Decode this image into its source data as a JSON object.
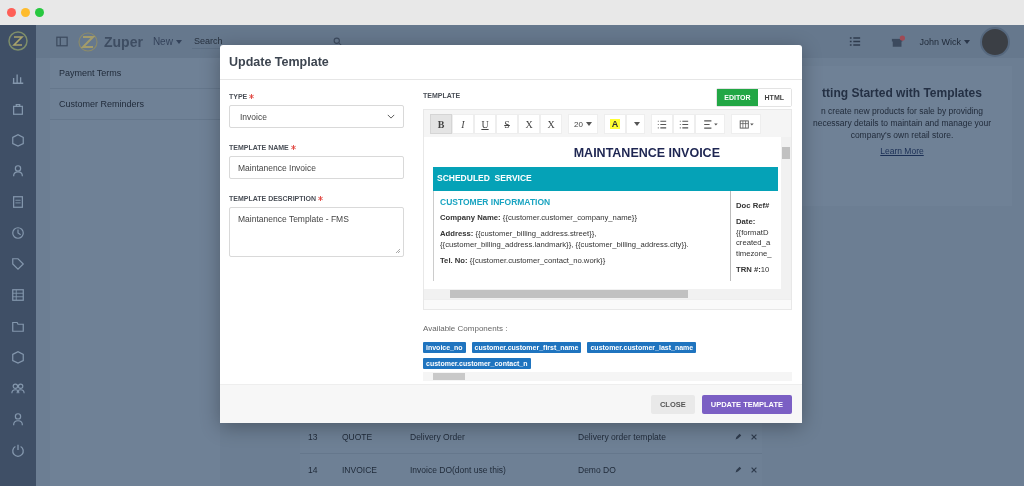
{
  "app": {
    "brand": "Zuper",
    "new_menu": "New",
    "search": {
      "placeholder": "Search"
    },
    "user": "John Wick"
  },
  "settings_list": [
    "Payment Terms",
    "Customer Reminders"
  ],
  "help_panel": {
    "title": "tting Started with Templates",
    "body": "n create new products for sale by providing necessary details to maintain and manage your company's own retail store.",
    "link": "Learn More"
  },
  "table": {
    "rows": [
      {
        "number": "13",
        "type": "QUOTE",
        "name": "Delivery Order",
        "description": "Delivery order template"
      },
      {
        "number": "14",
        "type": "INVOICE",
        "name": "Invoice DO(dont use this)",
        "description": "Demo DO"
      }
    ]
  },
  "modal": {
    "title": "Update Template",
    "fields": [
      {
        "kind": "select",
        "label": "TYPE",
        "required": true,
        "value": "Invoice"
      },
      {
        "kind": "input",
        "label": "TEMPLATE NAME",
        "required": true,
        "value": "Maintanence Invoice"
      },
      {
        "kind": "textarea",
        "label": "TEMPLATE DESCRIPTION",
        "required": true,
        "value": "Maintanence Template - FMS"
      }
    ],
    "editor": {
      "label": "TEMPLATE",
      "mode_tabs": [
        {
          "label": "EDITOR",
          "selected": true
        },
        {
          "label": "HTML",
          "selected": false
        }
      ],
      "toolbar": [
        {
          "kind": "bold",
          "label": "B",
          "selected": true
        },
        {
          "kind": "italic",
          "label": "I",
          "selected": false
        },
        {
          "kind": "underline",
          "label": "U",
          "selected": false
        },
        {
          "kind": "strike",
          "label": "S",
          "selected": false
        },
        {
          "kind": "sup",
          "label": "X",
          "selected": false
        },
        {
          "kind": "sub",
          "label": "X",
          "selected": false
        },
        {
          "kind": "size",
          "label": "20",
          "selected": false
        },
        {
          "kind": "highlight",
          "label": "A",
          "selected": false
        },
        {
          "kind": "bullets",
          "selected": false
        },
        {
          "kind": "numbers",
          "selected": false
        },
        {
          "kind": "align",
          "selected": false
        },
        {
          "kind": "table",
          "selected": false
        }
      ],
      "document": {
        "heading": "MAINTANENCE INVOICE",
        "banner": "SCHEDULED  SERVICE",
        "section_title": "CUSTOMER INFORMATION",
        "lines": [
          {
            "label": "Company Name:",
            "value": "{{customer.customer_company_name}}"
          },
          {
            "label": "Address:",
            "value": "{{customer_billing_address.street}}, {{customer_billing_address.landmark}}, {{customer_billing_address.city}}."
          },
          {
            "label": "Tel. No:",
            "value": "{{customer.customer_contact_no.work}}"
          }
        ],
        "side_lines": [
          {
            "label": "Doc Ref#"
          },
          {
            "label": "Date:",
            "value": "{{formatD created_a timezone_"
          },
          {
            "label": "TRN #:",
            "value": "10"
          }
        ]
      }
    },
    "components_label": "Available Components :",
    "components": [
      "invoice_no",
      "customer.customer_first_name",
      "customer.customer_last_name",
      "customer.customer_contact_n"
    ],
    "buttons": [
      {
        "kind": "secondary",
        "label": "CLOSE"
      },
      {
        "kind": "primary",
        "label": "UPDATE TEMPLATE"
      }
    ]
  }
}
